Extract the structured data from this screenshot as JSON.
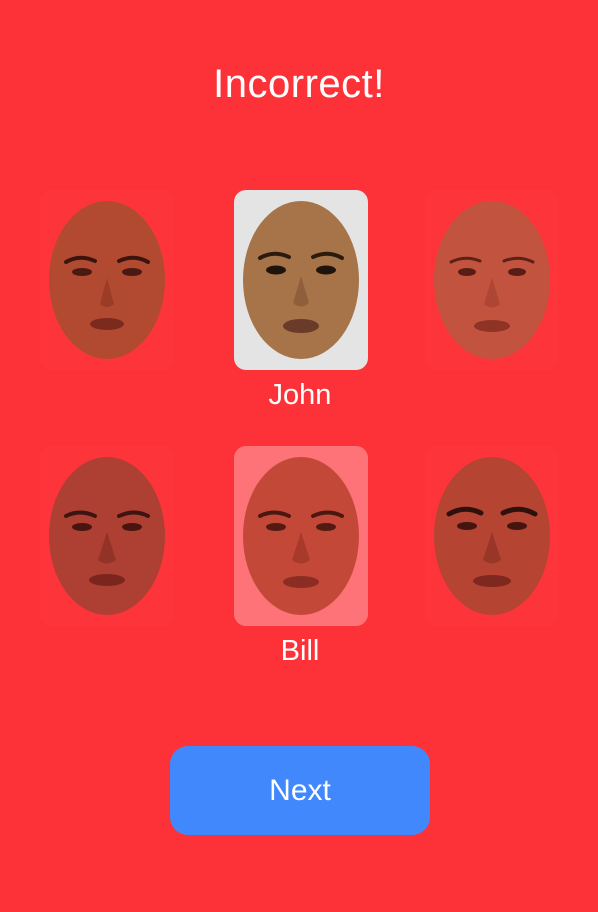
{
  "header": {
    "title": "Incorrect!"
  },
  "faces": [
    {
      "name": "",
      "state": "dim",
      "icon": "face-photo",
      "skin": "#b24a31"
    },
    {
      "name": "John",
      "state": "selected",
      "icon": "face-photo",
      "skin": "#a77449"
    },
    {
      "name": "",
      "state": "dim",
      "icon": "face-photo",
      "skin": "#c2533f"
    },
    {
      "name": "",
      "state": "dim",
      "icon": "face-photo",
      "skin": "#ad3f33"
    },
    {
      "name": "Bill",
      "state": "answer",
      "icon": "face-photo",
      "skin": "#c44838"
    },
    {
      "name": "",
      "state": "dim",
      "icon": "face-photo",
      "skin": "#b54433"
    }
  ],
  "footer": {
    "next_label": "Next"
  },
  "colors": {
    "background": "#fd3238",
    "button": "#4188fc",
    "selected_card": "#e4e4e4"
  }
}
